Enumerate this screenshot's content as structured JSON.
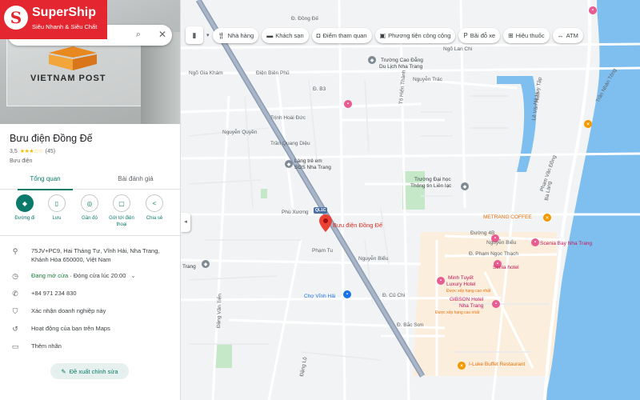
{
  "brand": {
    "name": "SuperShip",
    "tagline": "Siêu Nhanh & Siêu Chất",
    "logo_letter": "S",
    "color": "#e3262f"
  },
  "search": {
    "icons": [
      "search-icon",
      "close-icon"
    ]
  },
  "hero": {
    "sign_text": "VIETNAM POST"
  },
  "place": {
    "title": "Bưu điện Đồng Đế",
    "rating": "3,5",
    "stars": "★★★☆☆",
    "reviews": "(45)",
    "category": "Bưu điện"
  },
  "tabs": [
    {
      "label": "Tổng quan",
      "active": true
    },
    {
      "label": "Bài đánh giá",
      "active": false
    }
  ],
  "actions": [
    {
      "label": "Đường đi",
      "icon": "directions-icon"
    },
    {
      "label": "Lưu",
      "icon": "bookmark-icon"
    },
    {
      "label": "Gần đó",
      "icon": "nearby-icon"
    },
    {
      "label": "Gửi tới điện thoại",
      "icon": "send-to-phone-icon"
    },
    {
      "label": "Chia sẻ",
      "icon": "share-icon"
    }
  ],
  "info": {
    "address": "75JV+PC9, Hai Tháng Tư, Vĩnh Hải, Nha Trang, Khánh Hòa 650000, Việt Nam",
    "hours_status": "Đang mở cửa",
    "hours_detail": "· Đóng cửa lúc 20:00",
    "phone": "+84 971 234 830",
    "verify": "Xác nhận doanh nghiệp này",
    "activity": "Hoạt động của bạn trên Maps",
    "label": "Thêm nhãn"
  },
  "suggest_button": "Đề xuất chỉnh sửa",
  "chips": [
    {
      "label": "Nhà hàng",
      "icon": "restaurant-icon"
    },
    {
      "label": "Khách sạn",
      "icon": "hotel-icon"
    },
    {
      "label": "Điểm tham quan",
      "icon": "camera-icon"
    },
    {
      "label": "Phương tiện công cộng",
      "icon": "bus-icon"
    },
    {
      "label": "Bãi đỗ xe",
      "icon": "parking-icon"
    },
    {
      "label": "Hiệu thuốc",
      "icon": "pharmacy-icon"
    },
    {
      "label": "ATM",
      "icon": "atm-icon"
    }
  ],
  "map": {
    "pin_label": "Bưu điện Đồng Đế",
    "shield": "QL1C",
    "labels": {
      "ngo_lan_chi": "Ngõ Lan Chi",
      "dong_de": "Đ. Đồng Đế",
      "cao_dang": "Trường Cao Đẳng",
      "du_lich": "Du Lịch Nha Trang",
      "ngo_gia_kham": "Ngõ Gia Khám",
      "dien_bien_phu": "Điện Biên Phủ",
      "nguyen_trac": "Nguyễn Trác",
      "d_b3": "Đ. B3",
      "to_hien_thanh": "Tô Hiến Thành",
      "trinh_hoai_duc": "Trịnh Hoài Đức",
      "nguyen_quyen": "Nguyễn Quyền",
      "tran_quang_dieu": "Trần Quang Diệu",
      "lang_tre_em": "Làng trẻ em",
      "sos": "SOS Nha Trang",
      "dai_hoc": "Trường Đại học",
      "thong_tin": "Thông tin Liên lạc",
      "phu_xuong": "Phù Xương",
      "metrang": "METRANG COFFEE",
      "duong_4b": "Đường 4B",
      "nguyen_bieu": "Nguyễn Biểu",
      "scenia_bay": "Scenia Bay Nha Trang",
      "pham_ngoc_thach": "Đ. Phạm Ngọc Thạch",
      "pham_tu": "Phạm Tu",
      "nguyen_bieu_2": "Nguyễn Biểu",
      "senia": "Senia hotel",
      "minh_tuyet": "Minh Tuyết",
      "luxury": "Luxury Hotel",
      "duoc_xep_1": "Được xếp hạng cao nhất",
      "gibson": "GIBSON Hotel",
      "nha_trang_hotel": "Nha Trang",
      "duoc_xep_2": "Được xếp hạng cao nhất",
      "cho_vinh_hai": "Chợ Vĩnh Hải",
      "cu_chi": "Đ. Củ Chi",
      "bac_son": "Đ. Bắc Sơn",
      "iluke": "I-Luke Buffet Restaurant",
      "trang": "Trang",
      "pham_van_dong": "Phạm Văn Đồng",
      "tran_nhan_tong": "Trần Nhân Tông",
      "ba_lang": "Ba Làng",
      "dang_van_tien": "Đặng Văn Tiến",
      "dang_lo": "Đặng Lộ",
      "le_van_hien": "Lê Văn Hiên",
      "ha_huy_tap": "Hà Huy Tập"
    },
    "colors": {
      "land": "#f1f3f4",
      "road": "#ffffff",
      "highway": "#8c9cb3",
      "sea": "#7fbfef",
      "park": "#c5e8c8",
      "hotel_zone": "#fbeedc"
    }
  }
}
